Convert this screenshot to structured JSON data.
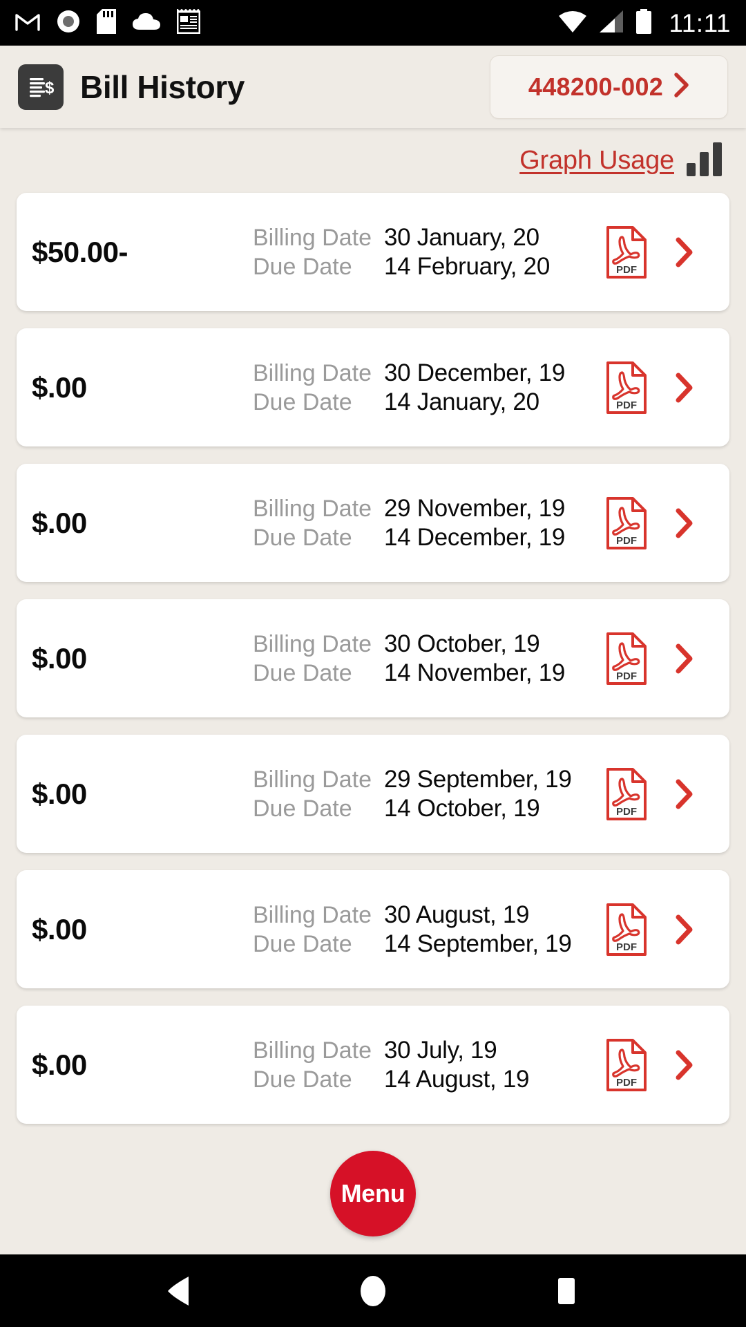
{
  "status_bar": {
    "time": "11:11",
    "left_icons": [
      "gmail-icon",
      "record-icon",
      "sd-card-icon",
      "cloud-icon",
      "notes-icon"
    ],
    "right_icons": [
      "wifi-icon",
      "cellular-signal-icon",
      "battery-icon"
    ]
  },
  "header": {
    "title": "Bill History",
    "icon": "bill-document-dollar-icon",
    "account_number": "448200-002",
    "account_chevron": "chevron-right-icon"
  },
  "toolbar": {
    "graph_usage_label": "Graph Usage",
    "graph_usage_icon": "bar-chart-icon"
  },
  "labels": {
    "billing_date": "Billing Date",
    "due_date": "Due Date",
    "pdf_icon_text": "PDF"
  },
  "bills": [
    {
      "amount": "$50.00-",
      "billing_date": "30 January, 20",
      "due_date": "14 February, 20"
    },
    {
      "amount": "$.00",
      "billing_date": "30 December, 19",
      "due_date": "14 January, 20"
    },
    {
      "amount": "$.00",
      "billing_date": "29 November, 19",
      "due_date": "14 December, 19"
    },
    {
      "amount": "$.00",
      "billing_date": "30 October, 19",
      "due_date": "14 November, 19"
    },
    {
      "amount": "$.00",
      "billing_date": "29 September, 19",
      "due_date": "14 October, 19"
    },
    {
      "amount": "$.00",
      "billing_date": "30 August, 19",
      "due_date": "14 September, 19"
    },
    {
      "amount": "$.00",
      "billing_date": "30 July, 19",
      "due_date": "14 August, 19"
    }
  ],
  "fab": {
    "label": "Menu"
  },
  "nav_bar": {
    "back": "back-triangle-icon",
    "home": "home-circle-icon",
    "recents": "recents-square-icon"
  },
  "colors": {
    "accent_red": "#C2332B",
    "fab_red": "#D61127",
    "pdf_red": "#D8342C",
    "page_background": "#EFEBE5",
    "card_background": "#FFFFFF",
    "header_icon": "#3B3B3B",
    "label_gray": "#9A9A9A"
  }
}
